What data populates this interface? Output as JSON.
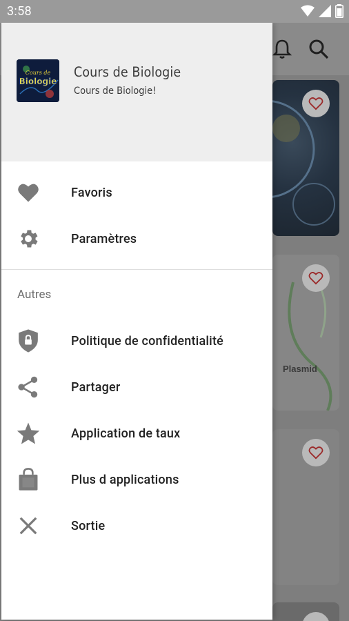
{
  "status_bar": {
    "time": "3:58"
  },
  "drawer": {
    "header": {
      "title": "Cours de Biologie",
      "subtitle": "Cours de Biologie!",
      "logo_text_top": "Cours de",
      "logo_text_main": "Biologie"
    },
    "main_items": [
      {
        "label": "Favoris",
        "icon": "heart-icon"
      },
      {
        "label": "Paramètres",
        "icon": "gear-icon"
      }
    ],
    "section_title": "Autres",
    "other_items": [
      {
        "label": "Politique de confidentialité",
        "icon": "shield-lock-icon"
      },
      {
        "label": "Partager",
        "icon": "share-icon"
      },
      {
        "label": "Application de taux",
        "icon": "star-icon"
      },
      {
        "label": "Plus d applications",
        "icon": "shopping-bag-icon"
      },
      {
        "label": "Sortie",
        "icon": "close-icon"
      }
    ]
  },
  "background": {
    "card2_text": "Plasmid"
  },
  "colors": {
    "icon_grey": "#7a7a7a",
    "header_bg": "#eeeeee",
    "scrim": "#7e7e7e"
  }
}
